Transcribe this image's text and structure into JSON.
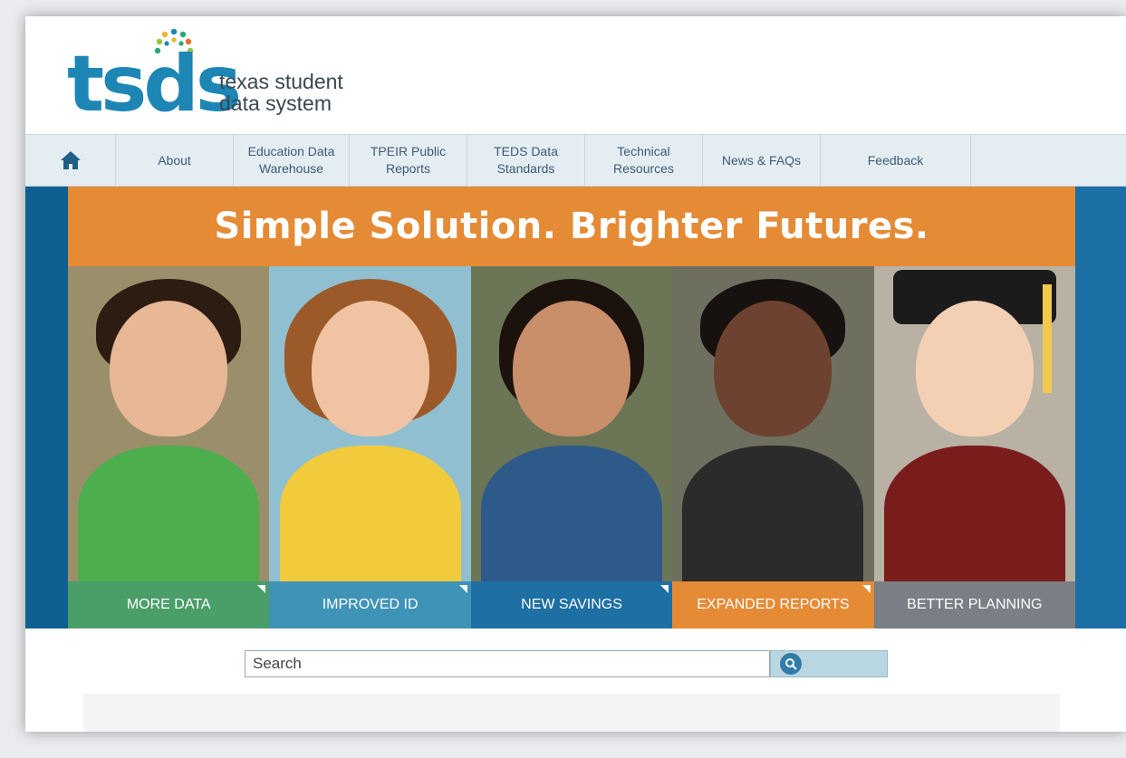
{
  "logo": {
    "word": "tsds",
    "tagline_line1": "texas student",
    "tagline_line2": "data system",
    "dot_colors": [
      "#2aa77a",
      "#f2b134",
      "#1d86b4",
      "#8fc742",
      "#e8702a"
    ]
  },
  "nav": {
    "home_icon": "home-icon",
    "items": [
      {
        "line1": "About",
        "line2": ""
      },
      {
        "line1": "Education Data",
        "line2": "Warehouse"
      },
      {
        "line1": "TPEIR Public",
        "line2": "Reports"
      },
      {
        "line1": "TEDS Data",
        "line2": "Standards"
      },
      {
        "line1": "Technical",
        "line2": "Resources"
      },
      {
        "line1": "News & FAQs",
        "line2": ""
      },
      {
        "line1": "Feedback",
        "line2": ""
      }
    ]
  },
  "hero": {
    "banner": "Simple Solution. Brighter Futures.",
    "tabs": [
      {
        "label": "More Data",
        "color": "#4a9e68"
      },
      {
        "label": "Improved ID",
        "color": "#3f93b7"
      },
      {
        "label": "New Savings",
        "color": "#1e6fa3"
      },
      {
        "label": "Expanded Reports",
        "color": "#e58a35"
      },
      {
        "label": "Better Planning",
        "color": "#7a7f85"
      }
    ]
  },
  "search": {
    "placeholder": "Search",
    "button_icon": "search-icon"
  },
  "colors": {
    "brand_blue": "#1d86b4",
    "banner_orange": "#e58a35",
    "nav_bg": "#e4edf2"
  }
}
